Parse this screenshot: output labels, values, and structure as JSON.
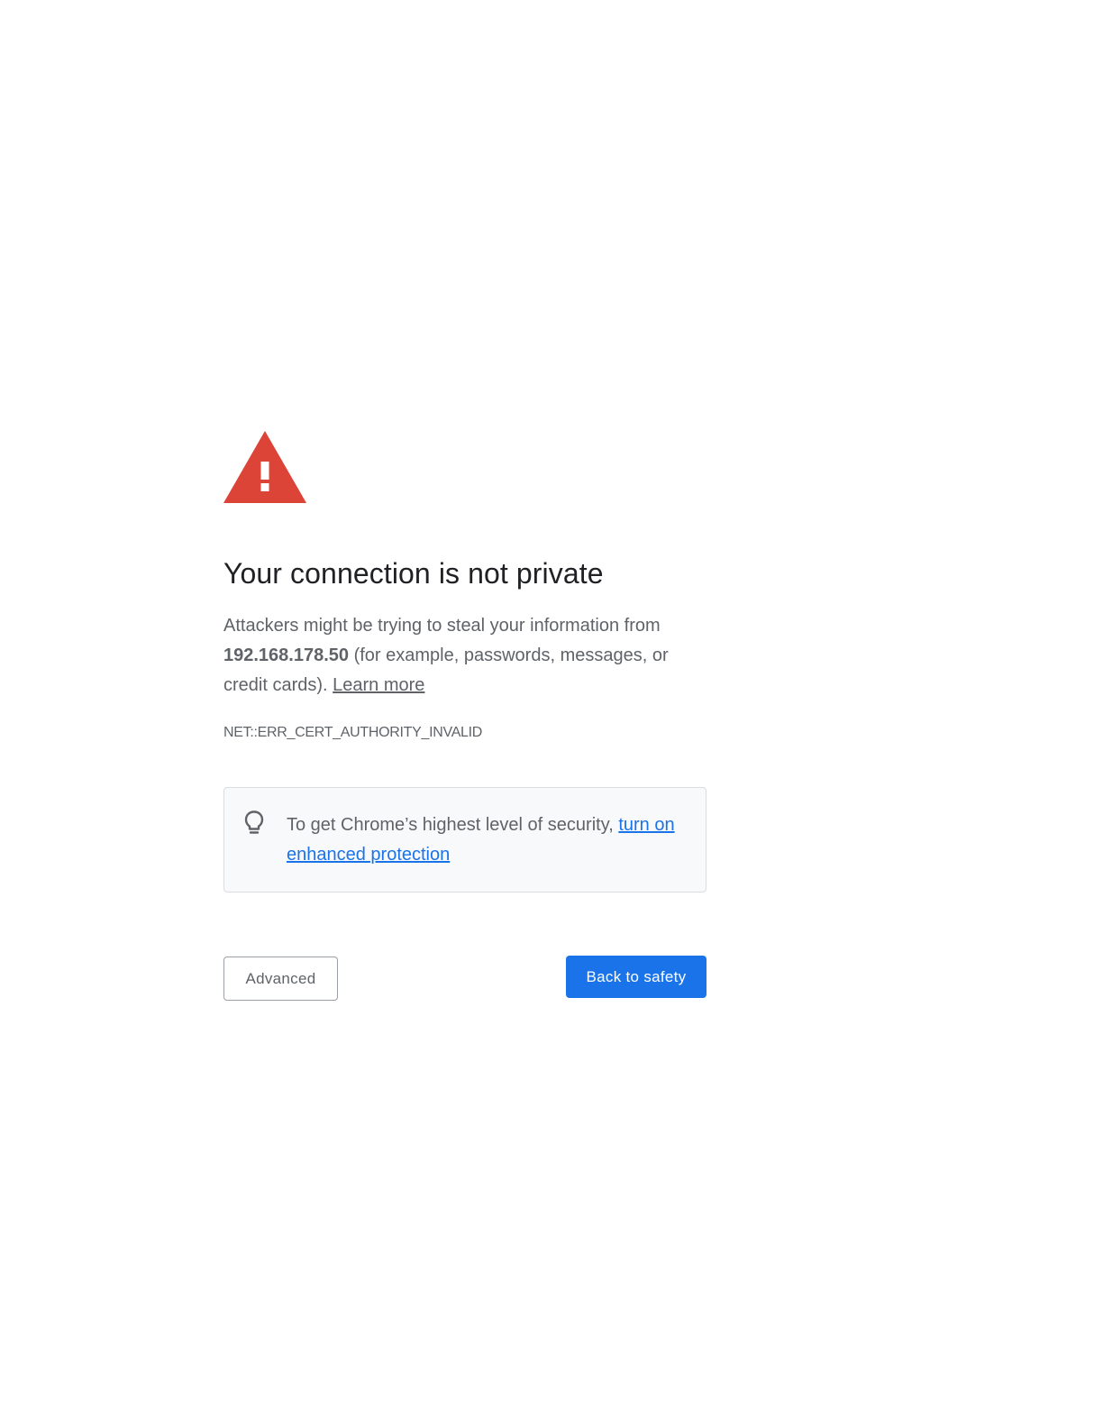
{
  "icons": {
    "warning": "warning-triangle-icon",
    "bulb": "lightbulb-icon"
  },
  "colors": {
    "warning_red": "#db4437",
    "primary_blue": "#1a73e8",
    "text_gray": "#5f6368",
    "title_dark": "#202124"
  },
  "main": {
    "title": "Your connection is not private",
    "explanation": {
      "prefix": "Attackers might be trying to steal your information from ",
      "host": "192.168.178.50",
      "suffix": " (for example, passwords, messages, or credit cards). ",
      "learn_more": "Learn more"
    },
    "error_code": "NET::ERR_CERT_AUTHORITY_INVALID",
    "enhanced_protection": {
      "text": "To get Chrome’s highest level of security, ",
      "link": "turn on enhanced protection"
    }
  },
  "buttons": {
    "advanced": "Advanced",
    "back_to_safety": "Back to safety"
  }
}
